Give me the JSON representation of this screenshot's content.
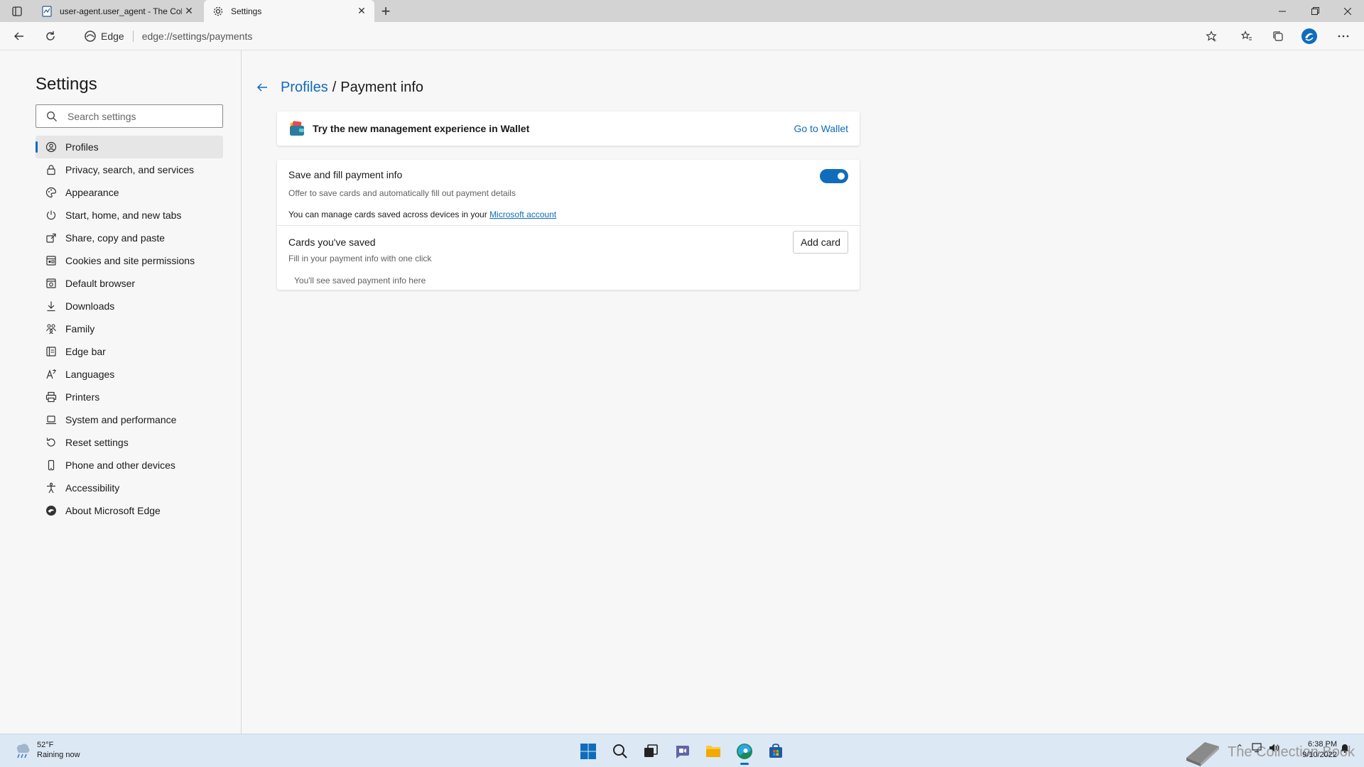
{
  "tabs": [
    {
      "title": "user-agent.user_agent - The Coll",
      "favicon": "document-icon",
      "active": false
    },
    {
      "title": "Settings",
      "favicon": "gear-icon",
      "active": true
    }
  ],
  "toolbar": {
    "site_label": "Edge",
    "url": "edge://settings/payments"
  },
  "sidebar": {
    "title": "Settings",
    "search_placeholder": "Search settings",
    "items": [
      {
        "label": "Profiles",
        "icon": "profile-icon",
        "active": true
      },
      {
        "label": "Privacy, search, and services",
        "icon": "lock-icon"
      },
      {
        "label": "Appearance",
        "icon": "palette-icon"
      },
      {
        "label": "Start, home, and new tabs",
        "icon": "power-icon"
      },
      {
        "label": "Share, copy and paste",
        "icon": "share-icon"
      },
      {
        "label": "Cookies and site permissions",
        "icon": "cookies-icon"
      },
      {
        "label": "Default browser",
        "icon": "browser-icon"
      },
      {
        "label": "Downloads",
        "icon": "download-icon"
      },
      {
        "label": "Family",
        "icon": "family-icon"
      },
      {
        "label": "Edge bar",
        "icon": "edge-bar-icon"
      },
      {
        "label": "Languages",
        "icon": "languages-icon"
      },
      {
        "label": "Printers",
        "icon": "printer-icon"
      },
      {
        "label": "System and performance",
        "icon": "laptop-icon"
      },
      {
        "label": "Reset settings",
        "icon": "reset-icon"
      },
      {
        "label": "Phone and other devices",
        "icon": "phone-icon"
      },
      {
        "label": "Accessibility",
        "icon": "accessibility-icon"
      },
      {
        "label": "About Microsoft Edge",
        "icon": "edge-logo-icon"
      }
    ]
  },
  "main": {
    "breadcrumb_parent": "Profiles",
    "breadcrumb_sep": "/",
    "breadcrumb_current": "Payment info",
    "wallet_banner": {
      "text": "Try the new management experience in Wallet",
      "link": "Go to Wallet"
    },
    "save_fill": {
      "title": "Save and fill payment info",
      "subtitle": "Offer to save cards and automatically fill out payment details",
      "note_prefix": "You can manage cards saved across devices in your ",
      "note_link": "Microsoft account",
      "enabled": true
    },
    "cards": {
      "title": "Cards you've saved",
      "subtitle": "Fill in your payment info with one click",
      "add_button": "Add card",
      "empty_text": "You'll see saved payment info here"
    }
  },
  "taskbar": {
    "weather_temp": "52°F",
    "weather_desc": "Raining now",
    "time": "6:38 PM",
    "date": "9/10/2022",
    "watermark": "The Collection Book"
  },
  "colors": {
    "accent": "#0f6cbd",
    "background": "#f7f7f7",
    "taskbar": "#dce8f4"
  }
}
